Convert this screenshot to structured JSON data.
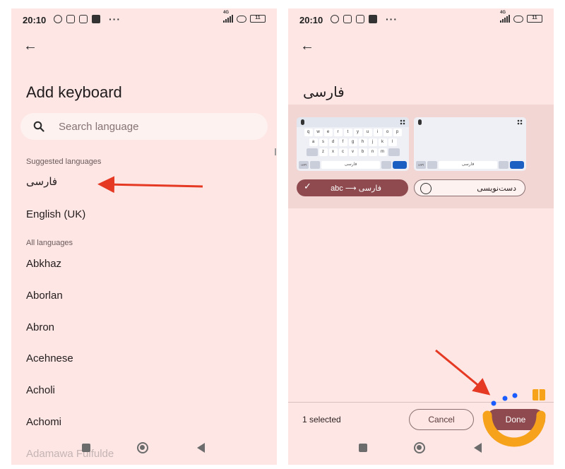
{
  "status_bar": {
    "time": "20:10",
    "network": "4G",
    "battery": "11"
  },
  "left": {
    "title": "Add keyboard",
    "search": {
      "placeholder": "Search language"
    },
    "suggested_header": "Suggested languages",
    "suggested": [
      "فارسی",
      "English (UK)"
    ],
    "all_header": "All languages",
    "all": [
      "Abkhaz",
      "Aborlan",
      "Abron",
      "Acehnese",
      "Acholi",
      "Achomi",
      "Adamawa Fulfulde"
    ]
  },
  "right": {
    "title": "فارسی",
    "keyboard_preview": {
      "row1": [
        "q",
        "w",
        "e",
        "r",
        "t",
        "y",
        "u",
        "i",
        "o",
        "p"
      ],
      "row2": [
        "a",
        "s",
        "d",
        "f",
        "g",
        "h",
        "j",
        "k",
        "l"
      ],
      "row3": [
        "z",
        "x",
        "c",
        "v",
        "b",
        "n",
        "m"
      ],
      "space_label": "فارسی",
      "num_key": "؟۱۲۳"
    },
    "layouts": [
      {
        "label": "abc ⟶ فارسی",
        "selected": true
      },
      {
        "label": "دست‌نویسی",
        "selected": false
      }
    ],
    "selected_count": "1 selected",
    "cancel_label": "Cancel",
    "done_label": "Done"
  },
  "colors": {
    "background": "#fde6e4",
    "primary": "#8e4a4e",
    "annotation_arrow": "#e53923",
    "logo_orange": "#f7a21b",
    "logo_blue": "#1a5cff"
  }
}
